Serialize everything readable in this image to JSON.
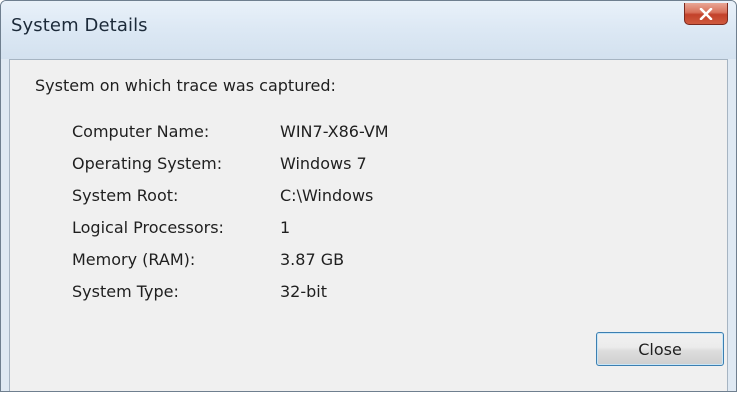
{
  "window": {
    "title": "System Details"
  },
  "dialog": {
    "intro": "System on which trace was captured:",
    "details": [
      {
        "label": "Computer Name:",
        "value": "WIN7-X86-VM"
      },
      {
        "label": "Operating System:",
        "value": "Windows 7"
      },
      {
        "label": "System Root:",
        "value": "C:\\Windows"
      },
      {
        "label": "Logical Processors:",
        "value": "1"
      },
      {
        "label": "Memory (RAM):",
        "value": "3.87 GB"
      },
      {
        "label": "System Type:",
        "value": "32-bit"
      }
    ],
    "close_button_label": "Close"
  },
  "icons": {
    "titlebar_close": "close-icon"
  },
  "colors": {
    "titlebar_close_bg": "#c94a32",
    "client_bg": "#f0f0f0",
    "button_border": "#3c7fb1"
  }
}
